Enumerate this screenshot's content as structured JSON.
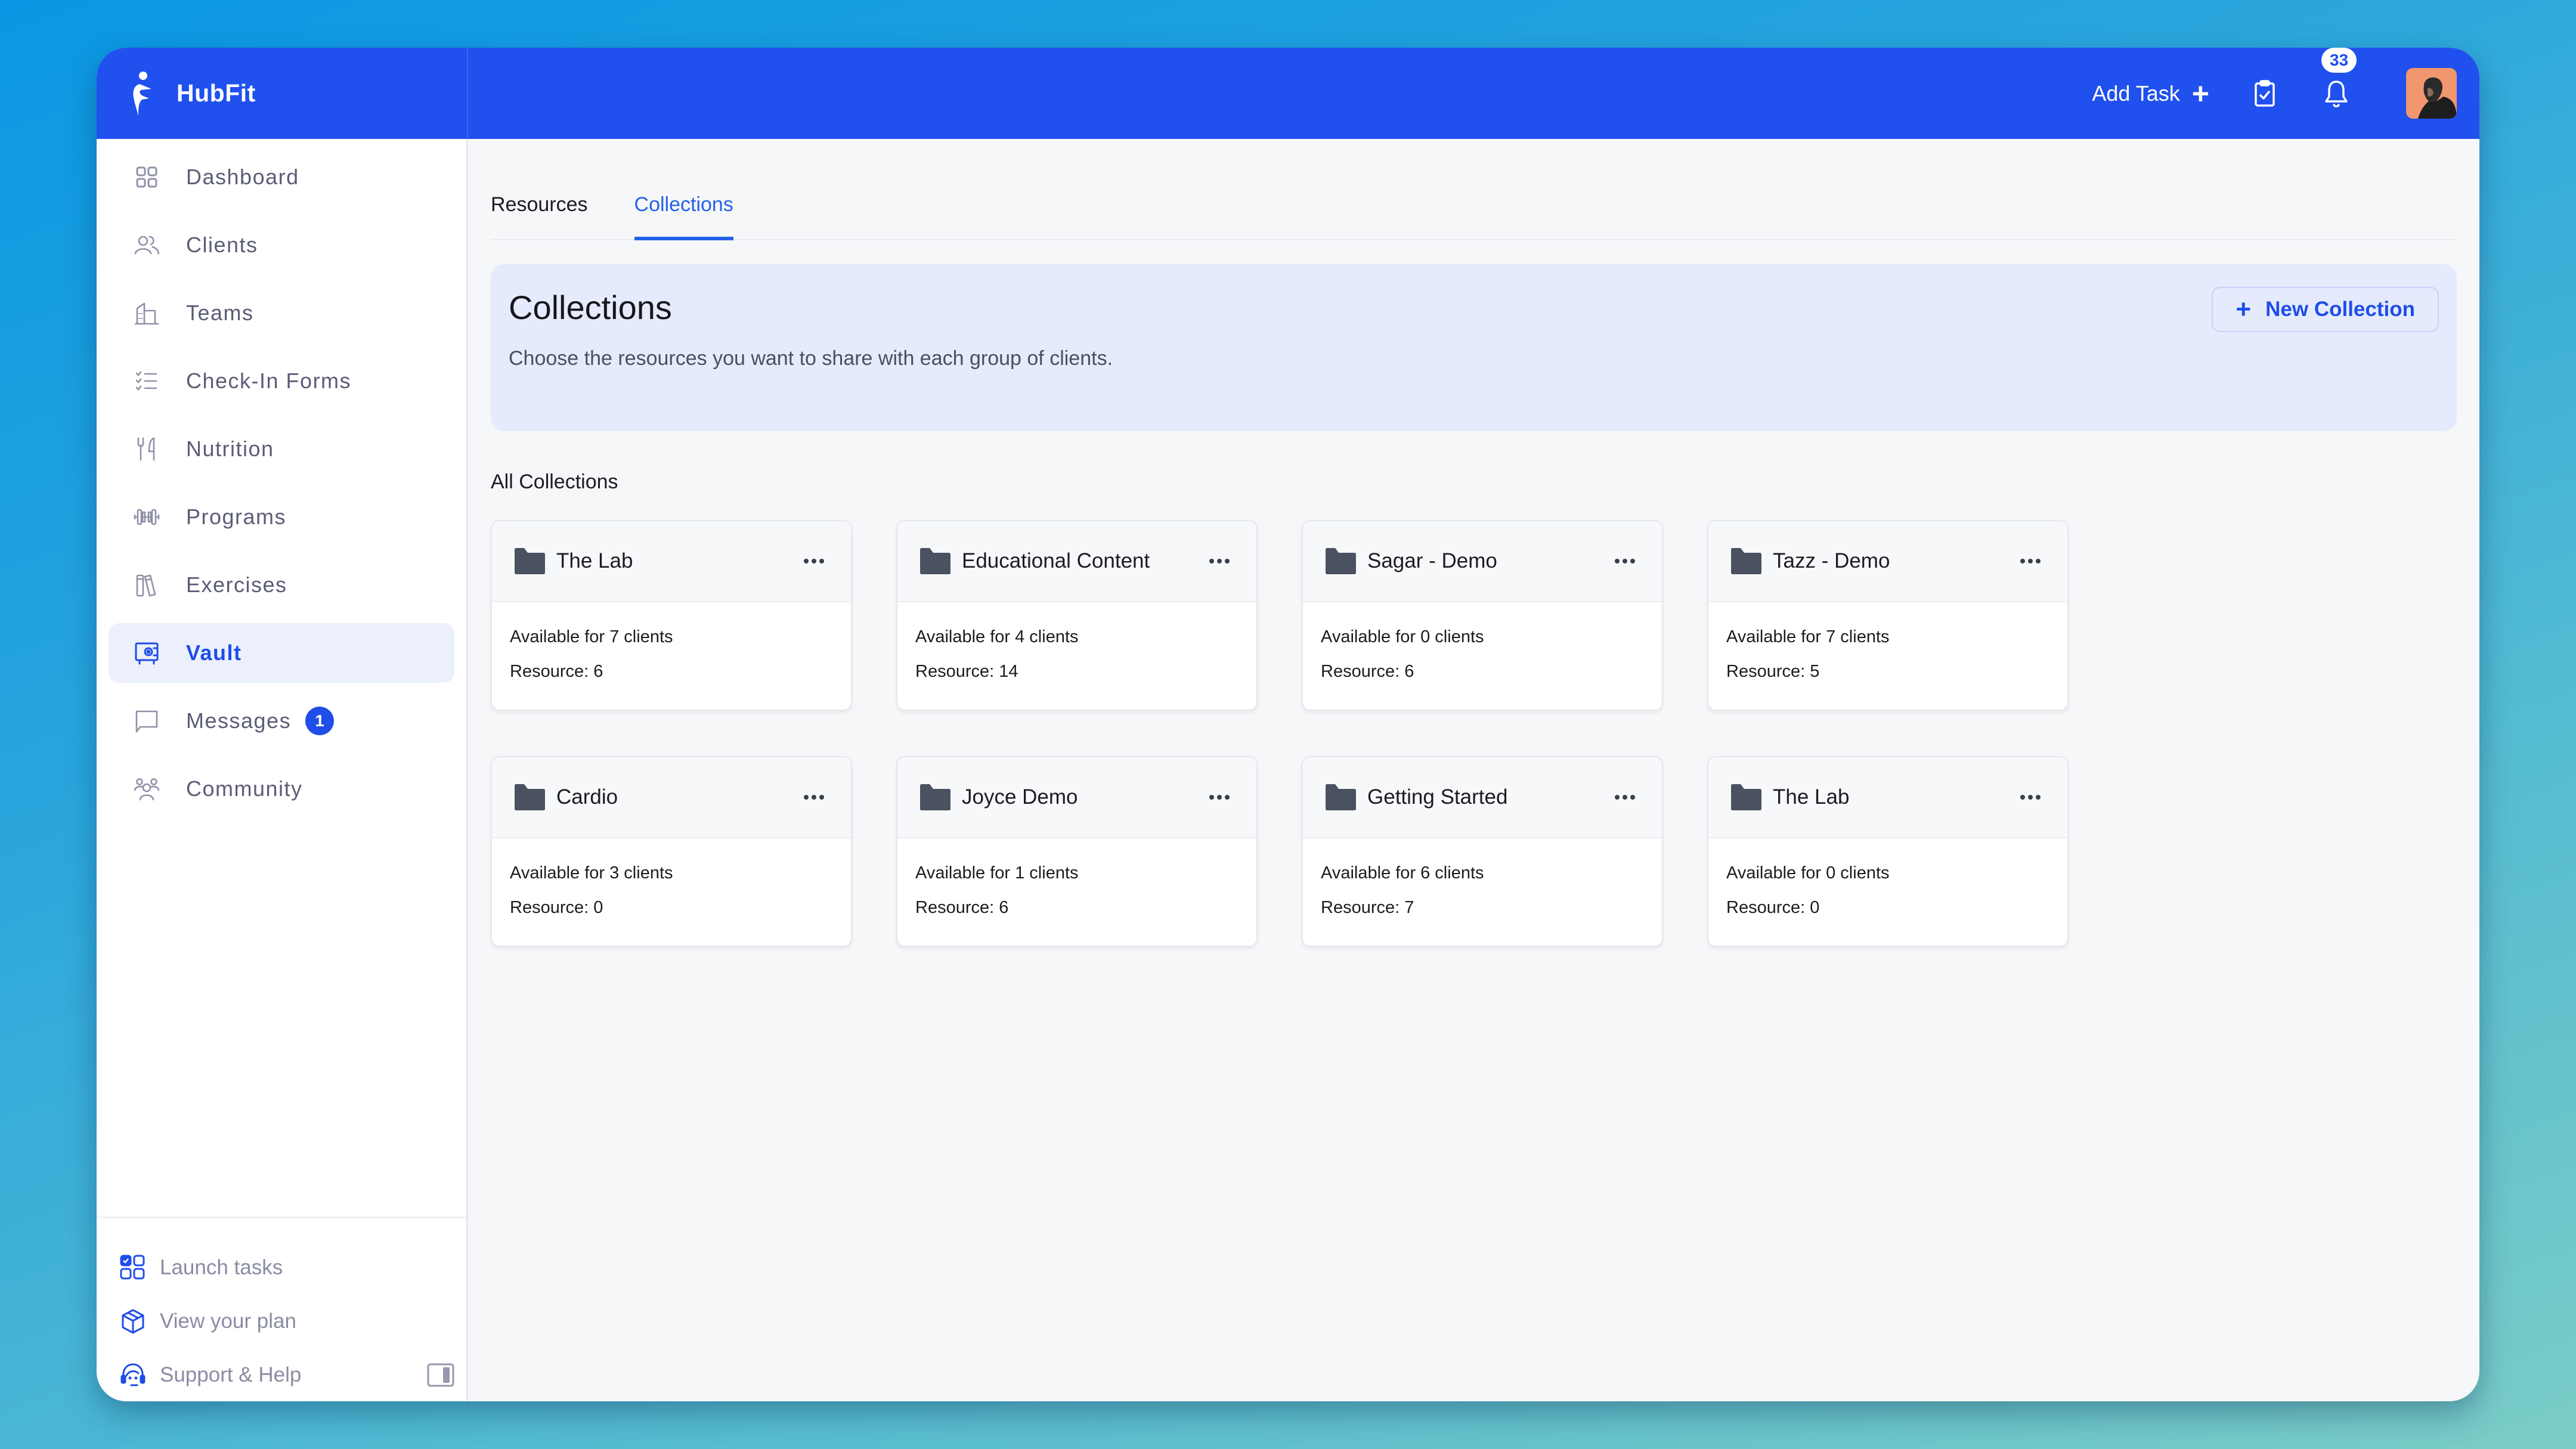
{
  "app": {
    "brand_name": "HubFit",
    "colors": {
      "primary": "#2050ee",
      "accent": "#1f4de8",
      "active_bg": "#ecf0fd"
    }
  },
  "header": {
    "add_task_label": "Add Task",
    "add_task_icon": "plus-icon",
    "tasks_icon": "clipboard-check-icon",
    "notifications_icon": "bell-icon",
    "notification_count": "33",
    "avatar_icon": "user-avatar"
  },
  "sidebar": {
    "items": [
      {
        "label": "Dashboard",
        "icon": "dashboard-grid-icon",
        "active": false
      },
      {
        "label": "Clients",
        "icon": "users-icon",
        "active": false
      },
      {
        "label": "Teams",
        "icon": "building-icon",
        "active": false
      },
      {
        "label": "Check-In Forms",
        "icon": "checklist-icon",
        "active": false
      },
      {
        "label": "Nutrition",
        "icon": "fork-knife-icon",
        "active": false
      },
      {
        "label": "Programs",
        "icon": "dumbbell-icon",
        "active": false
      },
      {
        "label": "Exercises",
        "icon": "books-icon",
        "active": false
      },
      {
        "label": "Vault",
        "icon": "vault-safe-icon",
        "active": true
      },
      {
        "label": "Messages",
        "icon": "message-icon",
        "active": false,
        "badge": "1"
      },
      {
        "label": "Community",
        "icon": "community-icon",
        "active": false
      }
    ],
    "bottom": [
      {
        "label": "Launch tasks",
        "icon": "launch-tasks-icon"
      },
      {
        "label": "View your plan",
        "icon": "package-box-icon"
      },
      {
        "label": "Support & Help",
        "icon": "headset-support-icon"
      }
    ],
    "collapse_icon": "sidebar-collapse-icon"
  },
  "main": {
    "tabs": [
      {
        "label": "Resources",
        "active": false
      },
      {
        "label": "Collections",
        "active": true
      }
    ],
    "hero": {
      "title": "Collections",
      "subtitle": "Choose the resources you want to share with each group of clients.",
      "new_button_label": "New Collection"
    },
    "section_label": "All Collections",
    "collections": [
      {
        "name": "The Lab",
        "clients": "Available for 7 clients",
        "resources": "Resource: 6"
      },
      {
        "name": "Educational Content",
        "clients": "Available for 4 clients",
        "resources": "Resource: 14"
      },
      {
        "name": "Sagar - Demo",
        "clients": "Available for 0 clients",
        "resources": "Resource: 6"
      },
      {
        "name": "Tazz - Demo",
        "clients": "Available for 7 clients",
        "resources": "Resource: 5"
      },
      {
        "name": "Cardio",
        "clients": "Available for 3 clients",
        "resources": "Resource: 0"
      },
      {
        "name": "Joyce Demo",
        "clients": "Available for 1 clients",
        "resources": "Resource: 6"
      },
      {
        "name": "Getting Started",
        "clients": "Available for 6 clients",
        "resources": "Resource: 7"
      },
      {
        "name": "The Lab",
        "clients": "Available for 0 clients",
        "resources": "Resource: 0"
      }
    ]
  }
}
